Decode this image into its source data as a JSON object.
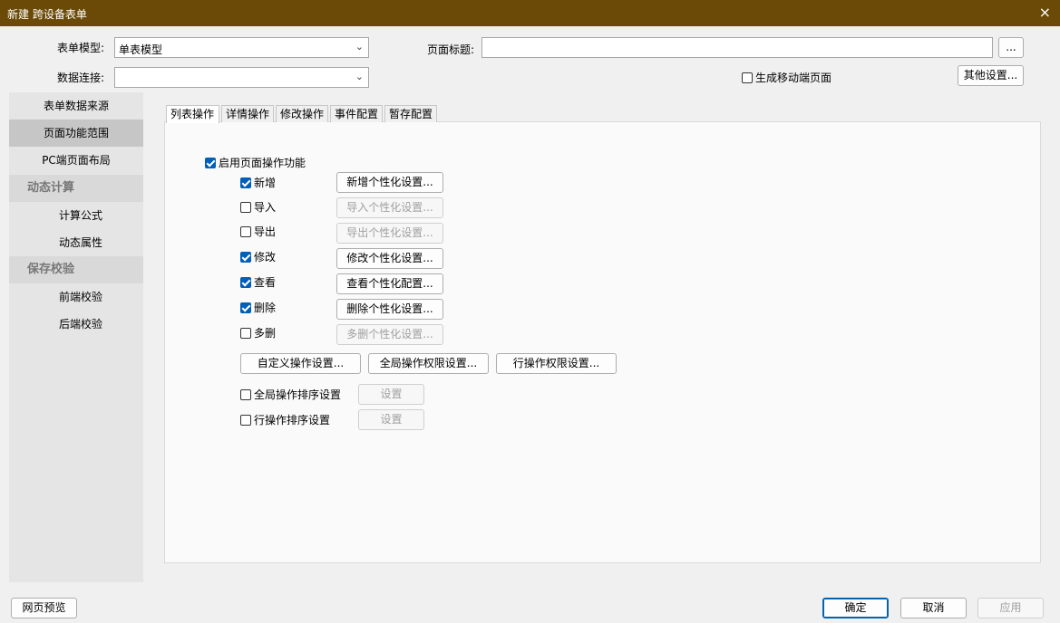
{
  "window": {
    "title": "新建 跨设备表单",
    "close_icon": "×"
  },
  "form": {
    "model_label": "表单模型:",
    "model_value": "单表模型",
    "connection_label": "数据连接:",
    "connection_value": "",
    "page_title_label": "页面标题:",
    "page_title_value": "",
    "browse_label": "...",
    "mobile_label": "生成移动端页面",
    "mobile_checked": false,
    "other_settings_label": "其他设置..."
  },
  "sidebar": {
    "items": [
      {
        "label": "表单数据来源",
        "selected": false
      },
      {
        "label": "页面功能范围",
        "selected": true
      },
      {
        "label": "PC端页面布局",
        "selected": false
      }
    ],
    "groups": [
      {
        "label": "动态计算",
        "items": [
          "计算公式",
          "动态属性"
        ]
      },
      {
        "label": "保存校验",
        "items": [
          "前端校验",
          "后端校验"
        ]
      }
    ]
  },
  "tabs": [
    "列表操作",
    "详情操作",
    "修改操作",
    "事件配置",
    "暂存配置"
  ],
  "active_tab": 0,
  "list_ops": {
    "enable_label": "启用页面操作功能",
    "enable_checked": true,
    "rows": [
      {
        "label": "新增",
        "checked": true,
        "button": "新增个性化设置...",
        "enabled": true
      },
      {
        "label": "导入",
        "checked": false,
        "button": "导入个性化设置...",
        "enabled": false
      },
      {
        "label": "导出",
        "checked": false,
        "button": "导出个性化设置...",
        "enabled": false
      },
      {
        "label": "修改",
        "checked": true,
        "button": "修改个性化设置...",
        "enabled": true
      },
      {
        "label": "查看",
        "checked": true,
        "button": "查看个性化配置...",
        "enabled": true
      },
      {
        "label": "删除",
        "checked": true,
        "button": "删除个性化设置...",
        "enabled": true
      },
      {
        "label": "多删",
        "checked": false,
        "button": "多删个性化设置...",
        "enabled": false
      }
    ],
    "custom_op_btn": "自定义操作设置...",
    "global_perm_btn": "全局操作权限设置...",
    "row_perm_btn": "行操作权限设置...",
    "global_sort_label": "全局操作排序设置",
    "global_sort_checked": false,
    "row_sort_label": "行操作排序设置",
    "row_sort_checked": false,
    "set_btn": "设置"
  },
  "footer": {
    "preview_label": "网页预览",
    "ok_label": "确定",
    "cancel_label": "取消",
    "apply_label": "应用"
  },
  "colors": {
    "titlebar": "#6b4a07",
    "accent": "#005fb8",
    "sidebar_selected": "#c6c6c6"
  }
}
